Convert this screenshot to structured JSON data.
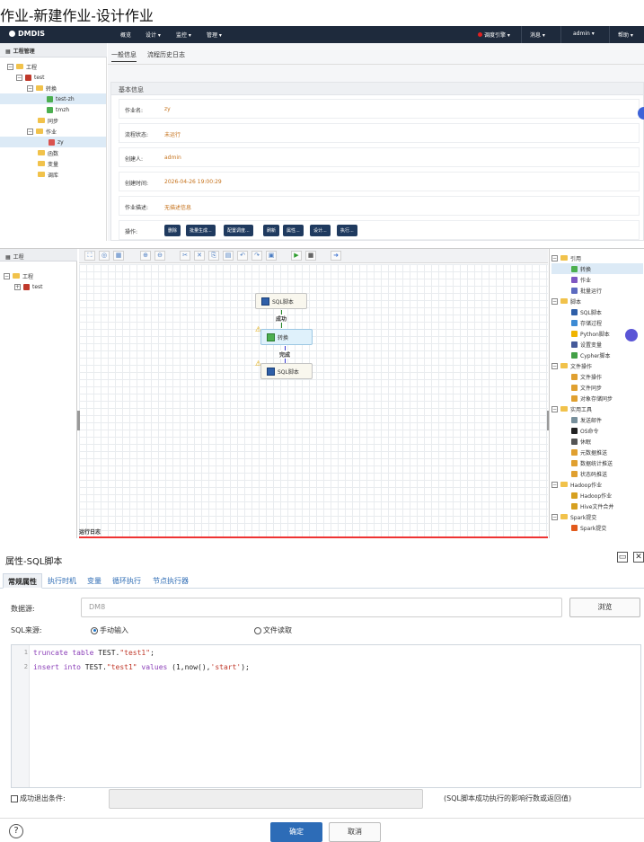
{
  "page_title": "作业-新建作业-设计作业",
  "topbar": {
    "logo": "DMDIS",
    "nav": [
      "概览",
      "设计 ▾",
      "监控 ▾",
      "管理 ▾"
    ],
    "right": [
      "调度引擎 ▾",
      "消息 ▾",
      "admin ▾",
      "帮助 ▾"
    ]
  },
  "project_panel": {
    "header": "工程管理",
    "tree": [
      {
        "label": "工程"
      },
      {
        "label": "test"
      },
      {
        "label": "转换"
      },
      {
        "label": "test-zh"
      },
      {
        "label": "tmzh"
      },
      {
        "label": "同步"
      },
      {
        "label": "作业"
      },
      {
        "label": "zy"
      },
      {
        "label": "函数"
      },
      {
        "label": "变量"
      },
      {
        "label": "调库"
      }
    ]
  },
  "job_info": {
    "tabs": [
      "一般信息",
      "流程历史日志"
    ],
    "section_title": "基本信息",
    "fields": [
      {
        "label": "作业名:",
        "value": "zy"
      },
      {
        "label": "流程状态:",
        "value": "未运行"
      },
      {
        "label": "创建人:",
        "value": "admin"
      },
      {
        "label": "创建时间:",
        "value": "2026-04-26 19:00:29"
      },
      {
        "label": "作业描述:",
        "value": "无描述信息"
      }
    ],
    "ops_label": "操作:",
    "ops": [
      "删除",
      "批量生成...",
      "配置调度...",
      "刷新",
      "属性...",
      "设计...",
      "执行..."
    ]
  },
  "designer": {
    "left_header": "工程",
    "left_tree": [
      "工程",
      "test"
    ],
    "nodes": [
      {
        "label": "SQL脚本"
      },
      {
        "label": "转换"
      },
      {
        "label": "SQL脚本"
      }
    ],
    "edges": [
      {
        "label": "成功"
      },
      {
        "label": "完成"
      }
    ],
    "log_tab": "运行日志",
    "palette": [
      {
        "label": "引用",
        "type": "group"
      },
      {
        "label": "转换",
        "type": "item",
        "color": "#4caf50"
      },
      {
        "label": "作业",
        "type": "item",
        "color": "#7e57c2"
      },
      {
        "label": "批量运行",
        "type": "item",
        "color": "#5c6bc0"
      },
      {
        "label": "脚本",
        "type": "group"
      },
      {
        "label": "SQL脚本",
        "type": "item",
        "color": "#2f5fa8"
      },
      {
        "label": "存储过程",
        "type": "item",
        "color": "#3d8bd4"
      },
      {
        "label": "Python脚本",
        "type": "item",
        "color": "#f0b400"
      },
      {
        "label": "设置变量",
        "type": "item",
        "color": "#455a9a"
      },
      {
        "label": "Cypher脚本",
        "type": "item",
        "color": "#43a047"
      },
      {
        "label": "文件操作",
        "type": "group"
      },
      {
        "label": "文件操作",
        "type": "item",
        "color": "#e0a030"
      },
      {
        "label": "文件同步",
        "type": "item",
        "color": "#e0a030"
      },
      {
        "label": "对象存储同步",
        "type": "item",
        "color": "#e0a030"
      },
      {
        "label": "实用工具",
        "type": "group"
      },
      {
        "label": "发送邮件",
        "type": "item",
        "color": "#78909c"
      },
      {
        "label": "OS命令",
        "type": "item",
        "color": "#222222"
      },
      {
        "label": "休眠",
        "type": "item",
        "color": "#555555"
      },
      {
        "label": "元数据推送",
        "type": "item",
        "color": "#e0a030"
      },
      {
        "label": "数据统计推送",
        "type": "item",
        "color": "#e0a030"
      },
      {
        "label": "状态码推送",
        "type": "item",
        "color": "#e0a030"
      },
      {
        "label": "Hadoop作业",
        "type": "group"
      },
      {
        "label": "Hadoop作业",
        "type": "item",
        "color": "#d6a020"
      },
      {
        "label": "Hive文件合并",
        "type": "item",
        "color": "#d6a020"
      },
      {
        "label": "Spark提交",
        "type": "group"
      },
      {
        "label": "Spark提交",
        "type": "item",
        "color": "#e25a1c"
      }
    ]
  },
  "dialog": {
    "title": "属性-SQL脚本",
    "tabs": [
      "常规属性",
      "执行时机",
      "变量",
      "循环执行",
      "节点执行器"
    ],
    "datasource_label": "数据源:",
    "datasource_placeholder": "DM8",
    "browse": "浏览",
    "sqlsource_label": "SQL来源:",
    "manual": "手动输入",
    "file": "文件读取",
    "code": {
      "lines": [
        {
          "no": "1",
          "kw": "truncate table",
          "rest": " TEST.",
          "str": "\"test1\"",
          "tail": ";"
        },
        {
          "no": "2",
          "kw": "insert into",
          "rest": " TEST.",
          "str": "\"test1\"",
          "kw2": " values",
          "tail2": " (1,now(),",
          "str2": "'start'",
          "end": ");"
        }
      ]
    },
    "exit_label": "成功退出条件:",
    "exit_hint": "(SQL脚本成功执行的影响行数或返回值)",
    "ok": "确定",
    "cancel": "取消",
    "help": "?"
  }
}
